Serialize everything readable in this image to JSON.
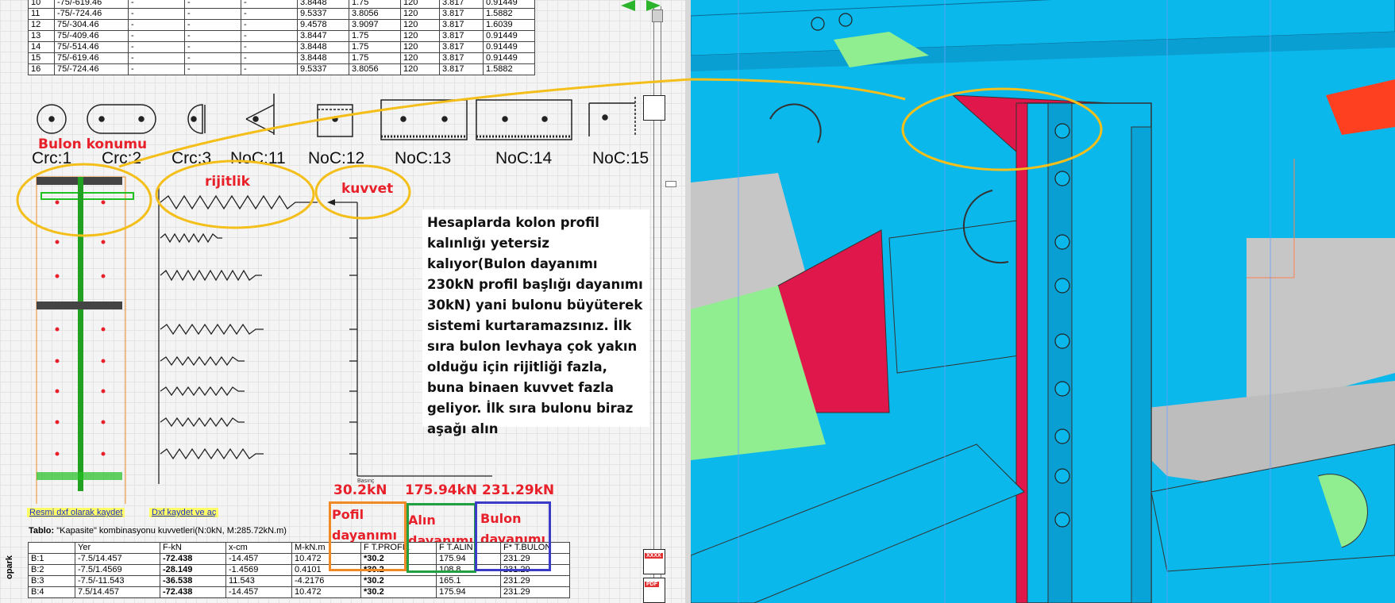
{
  "top_table": {
    "rows": [
      [
        "10",
        "-75/-619.46",
        "-",
        "-",
        "-",
        "3.8448",
        "1.75",
        "120",
        "3.817",
        "0.91449"
      ],
      [
        "11",
        "-75/-724.46",
        "-",
        "-",
        "-",
        "9.5337",
        "3.8056",
        "120",
        "3.817",
        "1.5882"
      ],
      [
        "12",
        "75/-304.46",
        "-",
        "-",
        "-",
        "9.4578",
        "3.9097",
        "120",
        "3.817",
        "1.6039"
      ],
      [
        "13",
        "75/-409.46",
        "-",
        "-",
        "-",
        "3.8447",
        "1.75",
        "120",
        "3.817",
        "0.91449"
      ],
      [
        "14",
        "75/-514.46",
        "-",
        "-",
        "-",
        "3.8448",
        "1.75",
        "120",
        "3.817",
        "0.91449"
      ],
      [
        "15",
        "75/-619.46",
        "-",
        "-",
        "-",
        "3.8448",
        "1.75",
        "120",
        "3.817",
        "0.91449"
      ],
      [
        "16",
        "75/-724.46",
        "-",
        "-",
        "-",
        "9.5337",
        "3.8056",
        "120",
        "3.817",
        "1.5882"
      ]
    ]
  },
  "bolt_types": [
    "Crc:1",
    "Crc:2",
    "Crc:3",
    "NoC:11",
    "NoC:12",
    "NoC:13",
    "NoC:14",
    "NoC:15"
  ],
  "annotations": {
    "bolt_position": "Bulon konumu",
    "stiffness": "rijitlik",
    "force": "kuvvet",
    "profile_force": "30.2kN",
    "front_force": "175.94kN",
    "bolt_force": "231.29kN",
    "profile_strength": "Pofil\ndayanımı",
    "front_strength": "Alın\ndayanımı",
    "bolt_strength": "Bulon\ndayanımı",
    "note": "Hesaplarda kolon profil kalınlığı yetersiz kalıyor(Bulon dayanımı 230kN profil başlığı dayanımı 30kN) yani bulonu büyüterek sistemi kurtaramazsınız. İlk sıra bulon levhaya çok yakın olduğu için rijitliği fazla, buna binaen kuvvet fazla geliyor. İlk sıra bulonu biraz aşağı alın"
  },
  "links": {
    "save_dxf": "Resmi dxf olarak kaydet",
    "save_open": "Dxf kaydet ve aç"
  },
  "chart_small_label": "Basınç",
  "tablo": {
    "prefix": "Tablo:",
    "title": "\"Kapasite\"  kombinasyonu  kuvvetleri(N:0kN,   M:285.72kN.m)",
    "headers": [
      "",
      "Yer",
      "F-kN",
      "x-cm",
      "M-kN.m",
      "F T.PROFIL",
      "F T.ALIN",
      "F* T.BULON"
    ],
    "rows": [
      [
        "B:1",
        "-7.5/14.457",
        "-72.438",
        "-14.457",
        "10.472",
        "*30.2",
        "175.94",
        "231.29"
      ],
      [
        "B:2",
        "-7.5/1.4569",
        "-28.149",
        "-1.4569",
        "0.4101",
        "*30.2",
        "108.8",
        "231.29"
      ],
      [
        "B:3",
        "-7.5/-11.543",
        "-36.538",
        "11.543",
        "-4.2176",
        "*30.2",
        "165.1",
        "231.29"
      ],
      [
        "B:4",
        "7.5/14.457",
        "-72.438",
        "-14.457",
        "10.472",
        "*30.2",
        "175.94",
        "231.29"
      ]
    ]
  },
  "side_label": "opark",
  "icons": {
    "xxxx": "XXXX",
    "pdf": "PDF"
  },
  "colors": {
    "cad_blue": "#0ab8ec",
    "cad_red": "#e0174a",
    "cad_green": "#90ee90",
    "yellow": "#f4bf1a"
  }
}
